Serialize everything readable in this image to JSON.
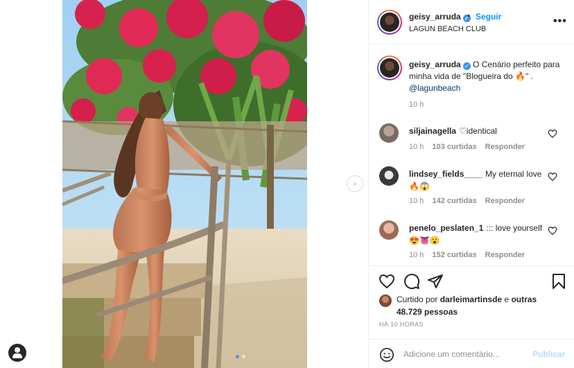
{
  "post": {
    "username": "geisy_arruda",
    "follow_label": "Seguir",
    "separator": "•",
    "location": "LAGUN BEACH CLUB",
    "more_label": "•••"
  },
  "caption": {
    "username": "geisy_arruda",
    "text": "O Cenário perfeito para minha vida de \"Blogueira do 🔥\" .",
    "mention": "@lagunbeach",
    "time": "10 h"
  },
  "comments": [
    {
      "username": "siljainagella",
      "text": "♡identical",
      "time": "10 h",
      "likes": "103 curtidas",
      "reply": "Responder",
      "avatar_color": "#8a7a72"
    },
    {
      "username": "lindsey_fields____",
      "text": "My eternal love 🔥😱",
      "time": "10 h",
      "likes": "142 curtidas",
      "reply": "Responder",
      "avatar_color": "#3a3a3a"
    },
    {
      "username": "penelo_peslaten_1",
      "text": "::: love yourself 😍👅😮",
      "time": "10 h",
      "likes": "152 curtidas",
      "reply": "Responder",
      "avatar_color": "#b97a68"
    }
  ],
  "likes": {
    "prefix": "Curtido por",
    "user": "darleimartinsde",
    "connector": "e",
    "others": "outras 48.729 pessoas"
  },
  "posted_ago": "HÁ 10 HORAS",
  "add_comment": {
    "placeholder": "Adicione um comentário...",
    "publish": "Publicar"
  },
  "carousel": {
    "next_icon": "chevron-right-icon",
    "slide_count": 2,
    "active_slide": 1
  },
  "colors": {
    "link": "#0095f6",
    "verified": "#3897f0",
    "meta": "#8e8e8e",
    "mention": "#00376b"
  }
}
